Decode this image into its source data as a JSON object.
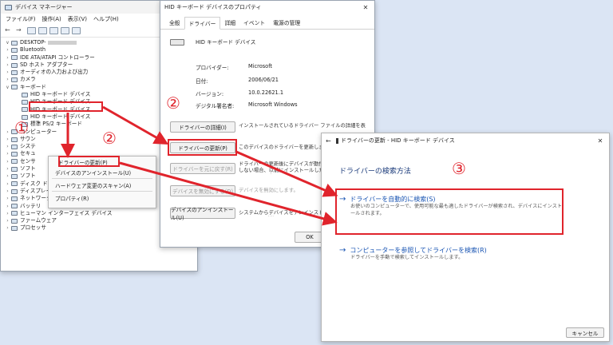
{
  "device_manager": {
    "title": "デバイス マネージャー",
    "menu": [
      "ファイル(F)",
      "操作(A)",
      "表示(V)",
      "ヘルプ(H)"
    ],
    "root": "DESKTOP-",
    "tree_items": [
      "Bluetooth",
      "IDE ATA/ATAPI コントローラー",
      "SD ホスト アダプター",
      "オーディオの入力および出力",
      "カメラ",
      "キーボード"
    ],
    "keyboard_children": [
      "HID キーボード デバイス",
      "HID キーボード デバイス",
      "HID キーボード デバイス",
      "HID キーボード デバイス",
      "標準 PS/2 キーボード"
    ],
    "tree_items_after": [
      "コンピューター",
      "サウン",
      "システ",
      "セキュ",
      "センサ",
      "ソフト",
      "ソフト",
      "ディスク ドライブ",
      "ディスプレイ アダプター",
      "ネットワーク アダプター",
      "バッテリ",
      "ヒューマン インターフェイス デバイス",
      "ファームウェア",
      "プロセッサ"
    ],
    "context_menu": [
      "ドライバーの更新(P)",
      "デバイスのアンインストール(U)",
      "ハードウェア変更のスキャン(A)",
      "プロパティ(R)"
    ]
  },
  "properties": {
    "title": "HID キーボード デバイスのプロパティ",
    "tabs": [
      "全般",
      "ドライバー",
      "詳細",
      "イベント",
      "電源の管理"
    ],
    "device_name": "HID キーボード デバイス",
    "rows": [
      {
        "label": "プロバイダー:",
        "value": "Microsoft"
      },
      {
        "label": "日付:",
        "value": "2006/06/21"
      },
      {
        "label": "バージョン:",
        "value": "10.0.22621.1"
      },
      {
        "label": "デジタル署名者:",
        "value": "Microsoft Windows"
      }
    ],
    "buttons": [
      {
        "label": "ドライバーの詳細(I)",
        "desc": "インストールされているドライバー ファイルの詳細を表示します。",
        "disabled": false
      },
      {
        "label": "ドライバーの更新(P)",
        "desc": "このデバイスのドライバーを更新します。",
        "disabled": false
      },
      {
        "label": "ドライバーを元に戻す(R)",
        "desc": "ドライバーの更新後にデバイスが動作しない場合、以前にインストールしたドライバーに戻します。",
        "disabled": true
      },
      {
        "label": "デバイスを無効にする(D)",
        "desc": "デバイスを無効にします。",
        "disabled": true
      },
      {
        "label": "デバイスのアンインストール(U)",
        "desc": "システムからデバイスをアンインストールします (詳細)。",
        "disabled": false
      }
    ],
    "ok": "OK"
  },
  "update_dialog": {
    "title": "ドライバーの更新 - HID キーボード デバイス",
    "heading": "ドライバーの検索方法",
    "option1_title": "ドライバーを自動的に検索(S)",
    "option1_desc": "お使いのコンピューターで、使用可能な最も適したドライバーが検索され、デバイスにインストールされます。",
    "option2_title": "コンピューターを参照してドライバーを検索(R)",
    "option2_desc": "ドライバーを手動で検索してインストールします。",
    "cancel": "キャンセル"
  },
  "annotations": {
    "step1": "①",
    "step2a": "②",
    "step2b": "②",
    "step3": "③"
  },
  "colors": {
    "annotation_red": "#e0242c",
    "link_blue": "#1a55b3",
    "background": "#dbe5f4"
  }
}
